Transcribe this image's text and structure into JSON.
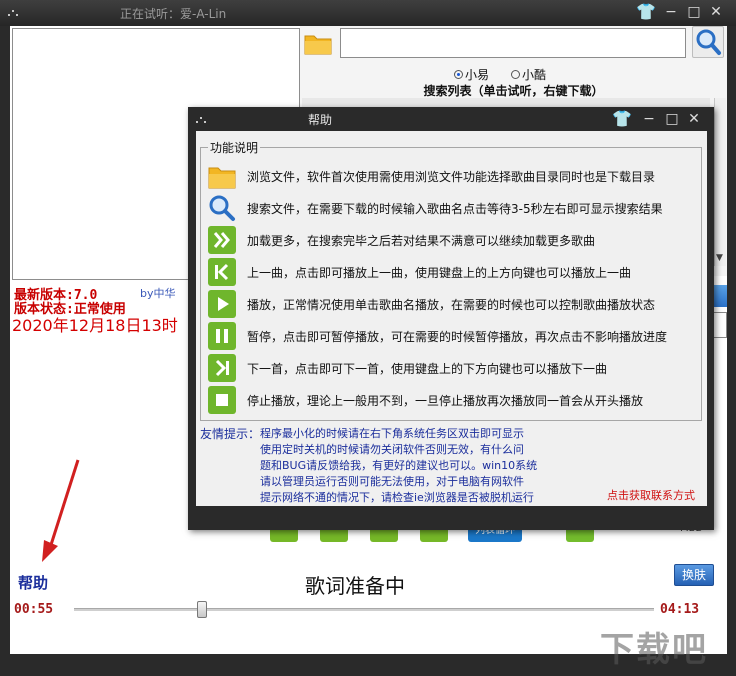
{
  "main_window": {
    "title": "正在试听：爱-A-Lin",
    "version_line": "最新版本:7.0",
    "status_line": "版本状态:正常使用",
    "by_text": "by中华",
    "date_text": "2020年12月18日13时",
    "help_label": "帮助",
    "lyrics_status": "歌词准备中",
    "skin_button": "换肤",
    "elapsed": "00:55",
    "duration": "04:13",
    "progress_fraction": 0.22,
    "playlist_mode_button": "列表循环",
    "mlg_label": "MLG",
    "watermark": "下载吧"
  },
  "search": {
    "input_value": "",
    "radio_options": [
      {
        "label": "小易",
        "selected": true
      },
      {
        "label": "小酷",
        "selected": false
      }
    ],
    "list_title": "搜索列表（单击试听，右键下载）"
  },
  "help_dialog": {
    "title": "帮助",
    "section_label": "功能说明",
    "features": [
      {
        "icon": "folder-icon",
        "text": "浏览文件，软件首次使用需使用浏览文件功能选择歌曲目录同时也是下载目录"
      },
      {
        "icon": "search-icon",
        "text": "搜索文件，在需要下载的时候输入歌曲名点击等待3-5秒左右即可显示搜索结果"
      },
      {
        "icon": "load-more-icon",
        "text": "加载更多，在搜索完毕之后若对结果不满意可以继续加载更多歌曲"
      },
      {
        "icon": "previous-icon",
        "text": "上一曲，点击即可播放上一曲，使用键盘上的上方向键也可以播放上一曲"
      },
      {
        "icon": "play-icon",
        "text": "播放，正常情况使用单击歌曲名播放，在需要的时候也可以控制歌曲播放状态"
      },
      {
        "icon": "pause-icon",
        "text": "暂停，点击即可暂停播放，可在需要的时候暂停播放，再次点击不影响播放进度"
      },
      {
        "icon": "next-icon",
        "text": "下一首，点击即可下一首，使用键盘上的下方向键也可以播放下一曲"
      },
      {
        "icon": "stop-icon",
        "text": "停止播放，理论上一般用不到，一旦停止播放再次播放同一首会从开头播放"
      }
    ],
    "tips_label": "友情提示：",
    "tips": [
      "程序最小化的时候请在右下角系统任务区双击即可显示",
      "使用定时关机的时候请勿关闭软件否则无效，有什么问",
      "题和BUG请反馈给我，有更好的建议也可以。win10系统",
      "请以管理员运行否则可能无法使用，对于电脑有网软件",
      "提示网络不通的情况下，请检查ie浏览器是否被脱机运行"
    ],
    "contact_link": "点击获取联系方式"
  },
  "colors": {
    "title_bar": "#2a2a2a",
    "accent_green": "#6fb62c",
    "accent_blue": "#2f8ee8",
    "red_text": "#c80000",
    "navy_text": "#1b2e9c"
  }
}
